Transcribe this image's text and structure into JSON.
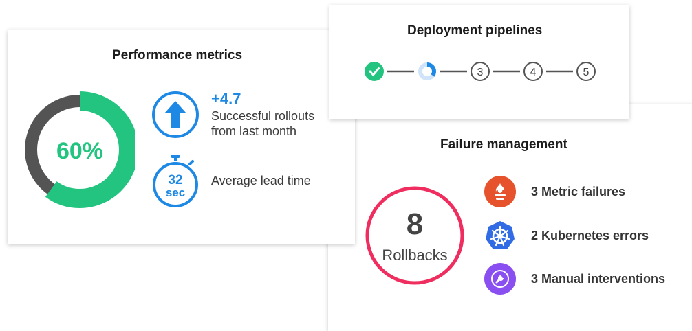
{
  "performance": {
    "title": "Performance metrics",
    "donut": {
      "percent": 60,
      "label": "60%",
      "fill_color": "#22c47f",
      "track_color": "#545454"
    },
    "rollouts": {
      "icon": "arrow-up-icon",
      "value": "+4.7",
      "text": "Successful rollouts\nfrom last month"
    },
    "lead_time": {
      "icon": "stopwatch-icon",
      "value_top": "32",
      "value_bottom": "sec",
      "text": "Average lead time"
    },
    "accent_color": "#1e88e5"
  },
  "deployment": {
    "title": "Deployment pipelines",
    "steps": [
      {
        "state": "done",
        "label": ""
      },
      {
        "state": "in-progress",
        "label": ""
      },
      {
        "state": "pending",
        "label": "3"
      },
      {
        "state": "pending",
        "label": "4"
      },
      {
        "state": "pending",
        "label": "5"
      }
    ]
  },
  "failure": {
    "title": "Failure management",
    "rollbacks": {
      "count": "8",
      "label": "Rollbacks",
      "ring_color": "#ef2d5e"
    },
    "items": [
      {
        "icon": "prometheus-icon",
        "color": "#e6522c",
        "label": "3 Metric failures"
      },
      {
        "icon": "kubernetes-icon",
        "color": "#326ce5",
        "label": "2 Kubernetes errors"
      },
      {
        "icon": "wrench-icon",
        "color": "#8a4ff0",
        "label": "3 Manual interventions"
      }
    ]
  }
}
